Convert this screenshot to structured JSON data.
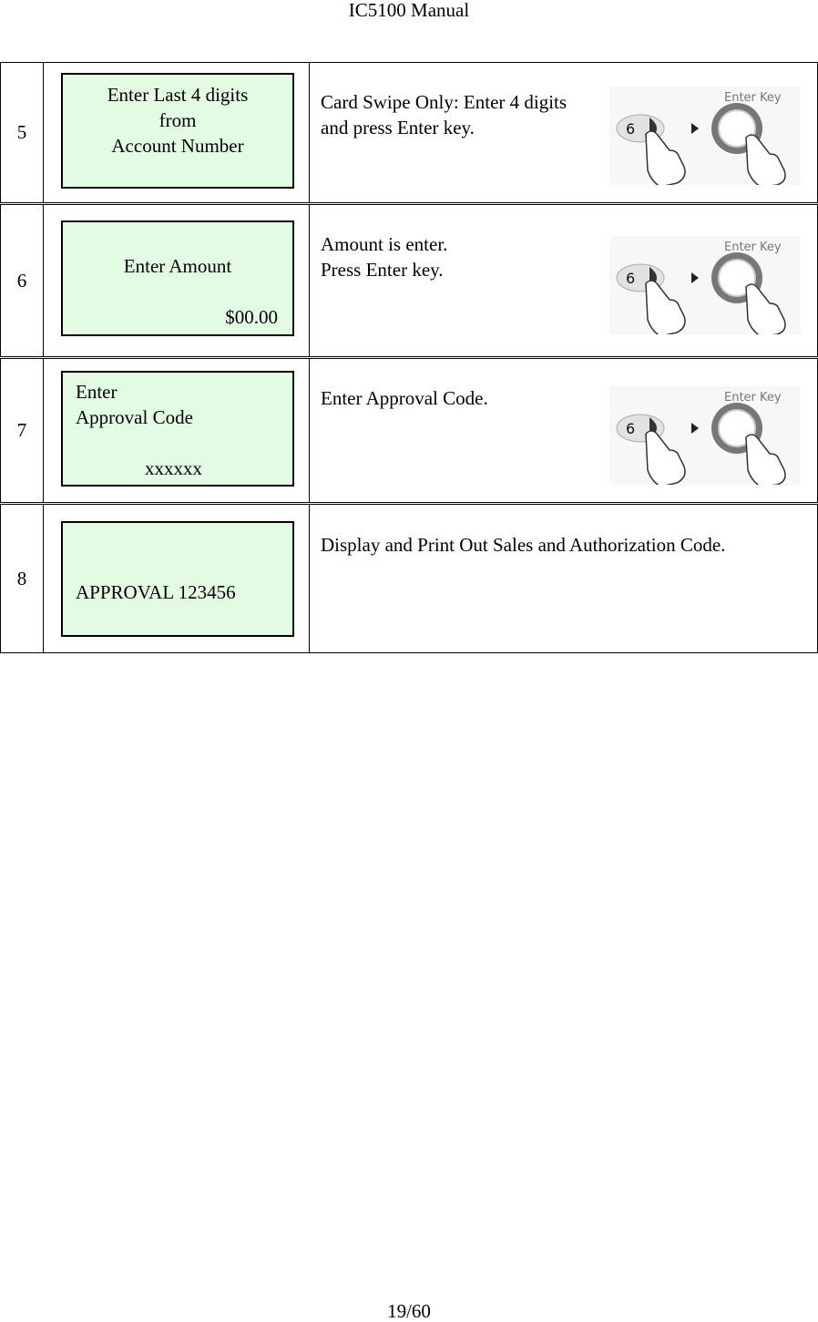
{
  "document": {
    "header_title": "IC5100 Manual",
    "page_number": "19/60"
  },
  "steps": [
    {
      "number": "5",
      "screen_lines": [
        "Enter Last 4 digits",
        "from",
        "Account Number"
      ],
      "description_lines": [
        "Card Swipe Only: Enter 4 digits",
        "and press Enter key."
      ],
      "key_image": {
        "key_label": "6",
        "enter_label": "Enter Key"
      }
    },
    {
      "number": "6",
      "screen_lines": [
        "Enter Amount",
        "$00.00"
      ],
      "description_lines": [
        "Amount is enter.",
        "Press Enter key."
      ],
      "key_image": {
        "key_label": "6",
        "enter_label": "Enter Key"
      }
    },
    {
      "number": "7",
      "screen_lines": [
        "Enter",
        "Approval Code",
        "xxxxxx"
      ],
      "description_lines": [
        "Enter Approval Code."
      ],
      "key_image": {
        "key_label": "6",
        "enter_label": "Enter Key"
      }
    },
    {
      "number": "8",
      "screen_lines": [
        "APPROVAL 123456"
      ],
      "description_lines": [
        "Display and Print Out Sales and Authorization Code."
      ]
    }
  ],
  "colors": {
    "lcd_background": "#e3fbe3",
    "border": "#000000"
  }
}
